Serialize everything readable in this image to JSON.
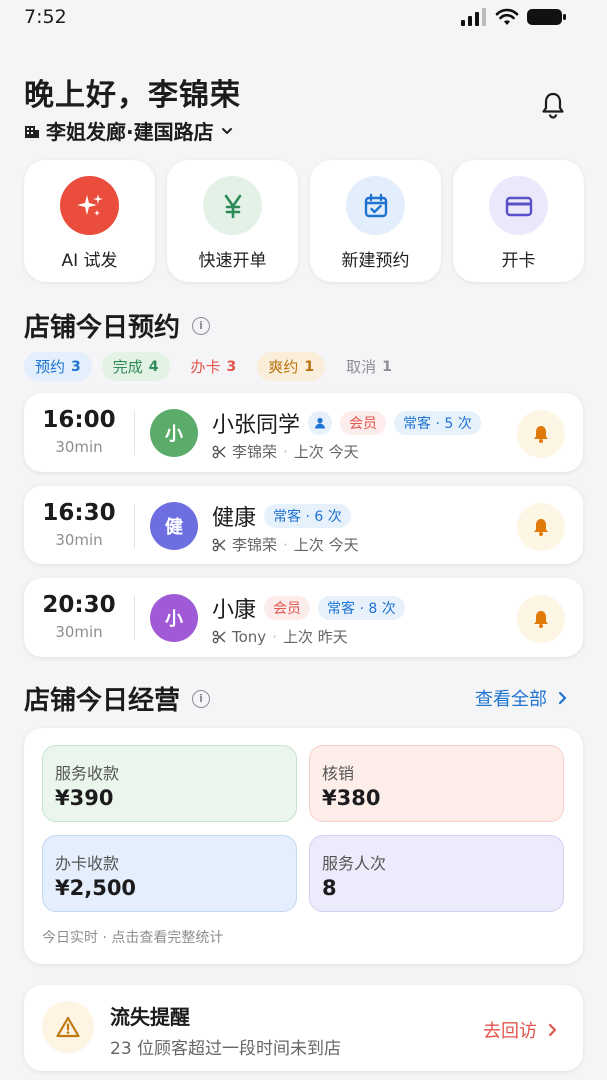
{
  "status_bar": {
    "time": "7:52"
  },
  "header": {
    "greeting": "晚上好，李锦荣",
    "store_name": "李姐发廊·建国路店"
  },
  "quick_actions": [
    {
      "label": "AI 试发",
      "icon": "sparkle-icon",
      "color": "#ea4d3c"
    },
    {
      "label": "快速开单",
      "icon": "yen-icon",
      "color": "#2e8b57"
    },
    {
      "label": "新建预约",
      "icon": "calendar-check-icon",
      "color": "#1f73d1"
    },
    {
      "label": "开卡",
      "icon": "card-icon",
      "color": "#5a50c8"
    }
  ],
  "appointments_section": {
    "title": "店铺今日预约",
    "filters": [
      {
        "label": "预约",
        "count": "3"
      },
      {
        "label": "完成",
        "count": "4"
      },
      {
        "label": "办卡",
        "count": "3"
      },
      {
        "label": "爽约",
        "count": "1"
      },
      {
        "label": "取消",
        "count": "1"
      }
    ],
    "items": [
      {
        "time": "16:00",
        "duration": "30min",
        "avatar": "小",
        "avatar_color": "#5bab6b",
        "name": "小张同学",
        "member_tag": "会员",
        "regular_tag": "常客 · 5 次",
        "stylist": "李锦荣",
        "last_visit": "上次 今天"
      },
      {
        "time": "16:30",
        "duration": "30min",
        "avatar": "健",
        "avatar_color": "#6d6fe0",
        "name": "健康",
        "regular_tag": "常客 · 6 次",
        "stylist": "李锦荣",
        "last_visit": "上次 今天"
      },
      {
        "time": "20:30",
        "duration": "30min",
        "avatar": "小",
        "avatar_color": "#a05ad6",
        "name": "小康",
        "member_tag": "会员",
        "regular_tag": "常客 · 8 次",
        "stylist": "Tony",
        "last_visit": "上次 昨天"
      }
    ]
  },
  "business_section": {
    "title": "店铺今日经营",
    "view_all": "查看全部",
    "stats": [
      {
        "label": "服务收款",
        "value": "¥390"
      },
      {
        "label": "核销",
        "value": "¥380"
      },
      {
        "label": "办卡收款",
        "value": "¥2,500"
      },
      {
        "label": "服务人次",
        "value": "8"
      }
    ],
    "note": "今日实时 · 点击查看完整统计"
  },
  "churn_alert": {
    "title": "流失提醒",
    "desc": "23 位顾客超过一段时间未到店",
    "action": "去回访"
  }
}
